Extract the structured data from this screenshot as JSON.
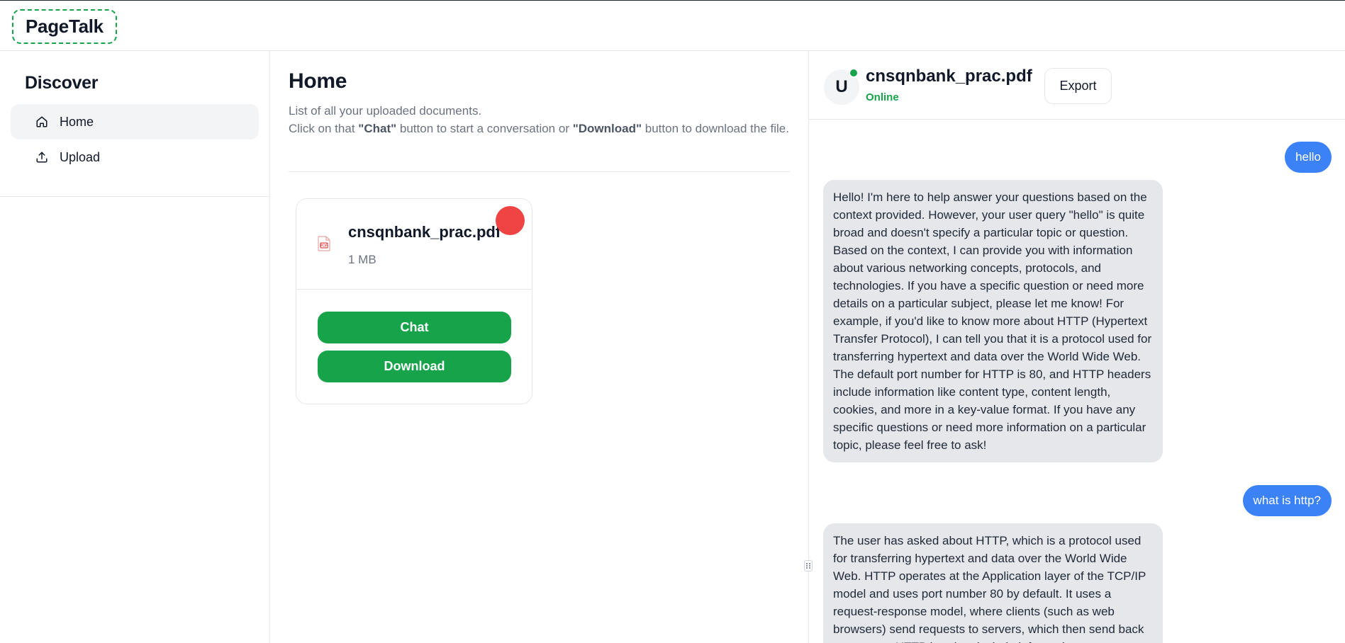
{
  "app": {
    "title": "PageTalk"
  },
  "sidebar": {
    "heading": "Discover",
    "items": [
      {
        "label": "Home",
        "icon": "home-icon",
        "active": true
      },
      {
        "label": "Upload",
        "icon": "upload-icon",
        "active": false
      }
    ]
  },
  "main": {
    "title": "Home",
    "desc_line1": "List of all your uploaded documents.",
    "desc_pre": "Click on that ",
    "desc_chat": "\"Chat\"",
    "desc_mid": " button to start a conversation or ",
    "desc_download": "\"Download\"",
    "desc_post": " button to download the file.",
    "documents": [
      {
        "name": "cnsqnbank_prac.pdf",
        "size": "1 MB",
        "chat_label": "Chat",
        "download_label": "Download"
      }
    ]
  },
  "chat": {
    "avatar_letter": "U",
    "title": "cnsqnbank_prac.pdf",
    "status": "Online",
    "export_label": "Export",
    "messages": [
      {
        "role": "user",
        "text": "hello"
      },
      {
        "role": "assistant",
        "text": "Hello! I'm here to help answer your questions based on the context provided. However, your user query \"hello\" is quite broad and doesn't specify a particular topic or question. Based on the context, I can provide you with information about various networking concepts, protocols, and technologies. If you have a specific question or need more details on a particular subject, please let me know! For example, if you'd like to know more about HTTP (Hypertext Transfer Protocol), I can tell you that it is a protocol used for transferring hypertext and data over the World Wide Web. The default port number for HTTP is 80, and HTTP headers include information like content type, content length, cookies, and more in a key-value format. If you have any specific questions or need more information on a particular topic, please feel free to ask!"
      },
      {
        "role": "user",
        "text": "what is http?"
      },
      {
        "role": "assistant",
        "text": "The user has asked about HTTP, which is a protocol used for transferring hypertext and data over the World Wide Web. HTTP operates at the Application layer of the TCP/IP model and uses port number 80 by default. It uses a request-response model, where clients (such as web browsers) send requests to servers, which then send back responses. HTTP headers include information"
      }
    ]
  },
  "colors": {
    "accent_green": "#16a34a",
    "user_bubble": "#3b82f6",
    "bot_bubble": "#e5e7eb",
    "alert_red": "#ef4444"
  }
}
